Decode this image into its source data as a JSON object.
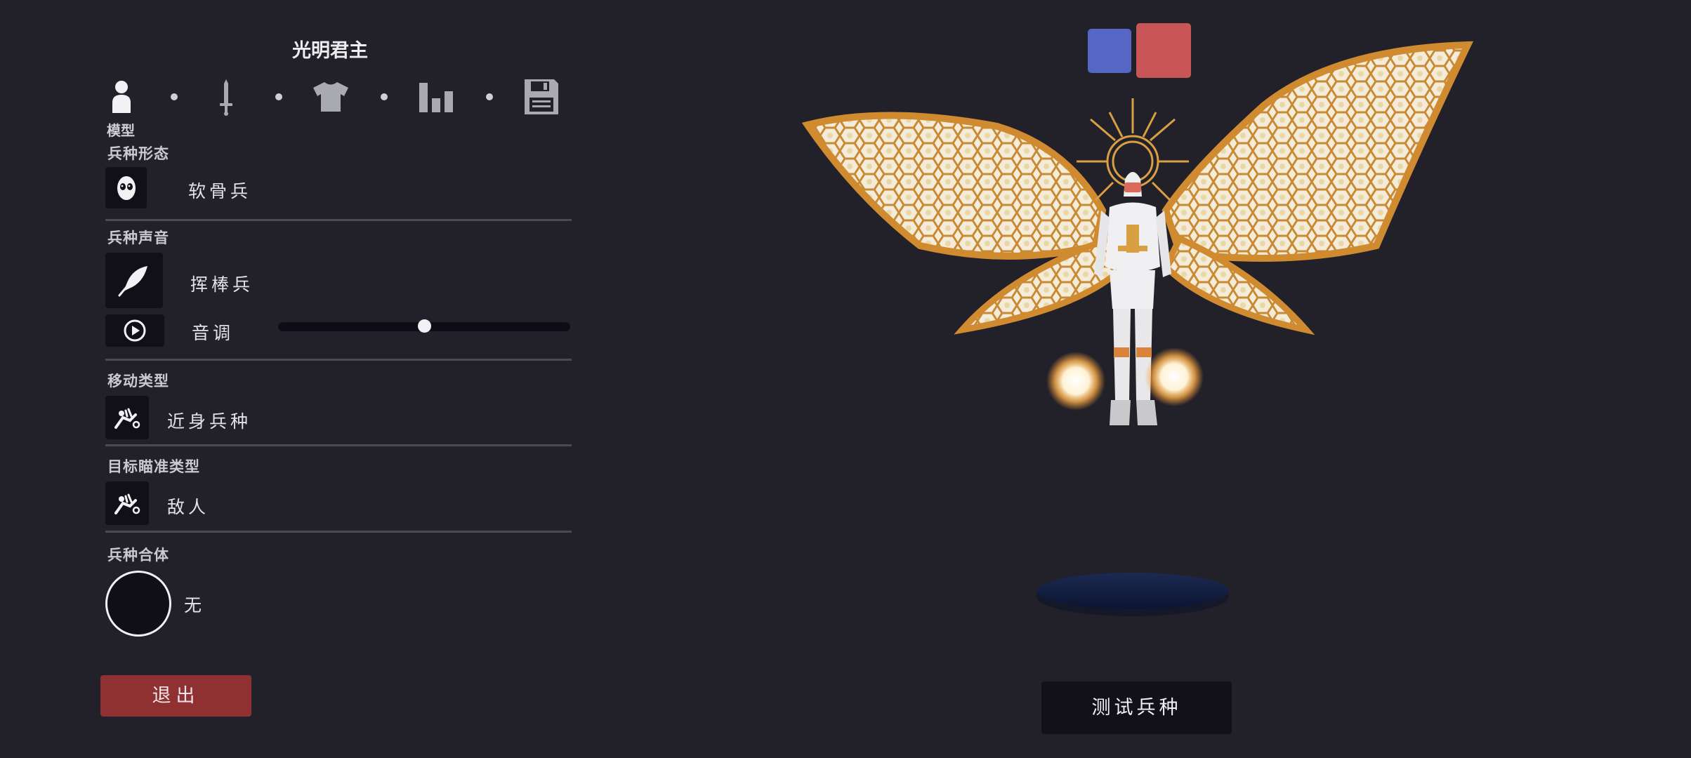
{
  "unit_name": "光明君主",
  "tabs": [
    {
      "name": "model",
      "icon": "person-icon"
    },
    {
      "name": "weapons",
      "icon": "sword-icon"
    },
    {
      "name": "clothing",
      "icon": "shirt-icon"
    },
    {
      "name": "stats",
      "icon": "bar-chart-icon"
    },
    {
      "name": "save",
      "icon": "floppy-disk-icon"
    }
  ],
  "active_tab_label": "模型",
  "sections": {
    "unit_form": {
      "label": "兵种形态",
      "value": "软骨兵",
      "icon": "skull-mask-icon"
    },
    "unit_voice": {
      "label": "兵种声音",
      "value": "挥棒兵",
      "icon": "feather-icon"
    },
    "pitch": {
      "label": "音调",
      "icon": "play-icon",
      "value": 0.5
    },
    "movement_type": {
      "label": "移动类型",
      "value": "近身兵种",
      "icon": "melee-unit-icon"
    },
    "target_type": {
      "label": "目标瞄准类型",
      "value": "敌人",
      "icon": "melee-unit-icon"
    },
    "unit_merge": {
      "label": "兵种合体",
      "value": "无"
    }
  },
  "buttons": {
    "exit": "退出",
    "test_unit": "测试兵种"
  },
  "teams": {
    "blue_color": "#5566c4",
    "red_color": "#c85656"
  },
  "colors": {
    "background": "#22212a",
    "exit_button": "#8f3033",
    "slider_track": "#0e0d17"
  }
}
